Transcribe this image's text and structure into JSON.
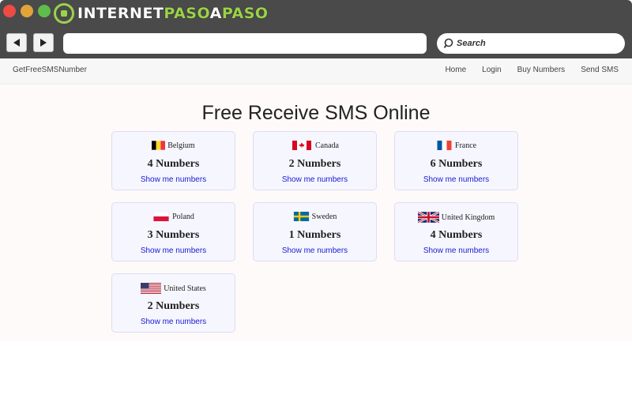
{
  "browser": {
    "logo_part1": "INTERNET",
    "logo_part2": "PASO",
    "logo_part3": "A",
    "logo_part4": "PASO",
    "search_placeholder": "Search",
    "back_icon": "back-arrow-icon",
    "forward_icon": "forward-arrow-icon"
  },
  "nav": {
    "brand": "GetFreeSMSNumber",
    "links": [
      "Home",
      "Login",
      "Buy Numbers",
      "Send SMS"
    ]
  },
  "page": {
    "title": "Free Receive SMS Online",
    "link_label": "Show me numbers"
  },
  "countries": [
    {
      "name": "Belgium",
      "count": "4 Numbers",
      "flag": "belgium-flag-icon"
    },
    {
      "name": "Canada",
      "count": "2 Numbers",
      "flag": "canada-flag-icon"
    },
    {
      "name": "France",
      "count": "6 Numbers",
      "flag": "france-flag-icon"
    },
    {
      "name": "Poland",
      "count": "3 Numbers",
      "flag": "poland-flag-icon"
    },
    {
      "name": "Sweden",
      "count": "1 Numbers",
      "flag": "sweden-flag-icon"
    },
    {
      "name": "United Kingdom",
      "count": "4 Numbers",
      "flag": "uk-flag-icon"
    },
    {
      "name": "United States",
      "count": "2 Numbers",
      "flag": "us-flag-icon"
    }
  ],
  "colors": {
    "link": "#1a1ad1",
    "card_bg": "#f6f6ff",
    "card_border": "#dedcf2",
    "titlebar": "#4a4a4a",
    "logo_accent": "#9bd24a"
  }
}
